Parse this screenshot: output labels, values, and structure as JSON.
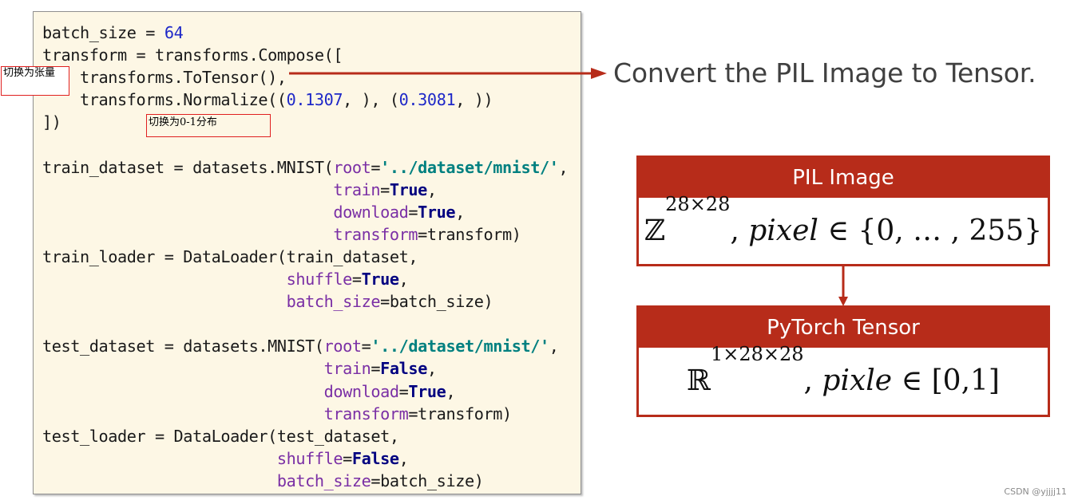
{
  "code": {
    "l01": "batch_size = ",
    "l01_num": "64",
    "l02": "transform = transforms.Compose([",
    "l03": "    transforms.ToTensor(),",
    "l04_a": "    transforms.Normalize((",
    "l04_n1": "0.1307",
    "l04_b": ", ), (",
    "l04_n2": "0.3081",
    "l04_c": ", ))",
    "l05": "])",
    "l07_a": "train_dataset = datasets.MNIST(",
    "l07_kw": "root",
    "l07_eq": "=",
    "l07_str": "'../dataset/mnist/'",
    "l07_end": ",",
    "l08_kw": "train",
    "l08_val": "True",
    "l09_kw": "download",
    "l09_val": "True",
    "l10_kw": "transform",
    "l10_val": "=transform)",
    "l11_a": "train_loader = DataLoader(train_dataset,",
    "l12_kw": "shuffle",
    "l12_val": "True",
    "l13_kw": "batch_size",
    "l13_val": "=batch_size)",
    "l15_a": "test_dataset = datasets.MNIST(",
    "l15_kw": "root",
    "l15_str": "'../dataset/mnist/'",
    "l16_kw": "train",
    "l16_val": "False",
    "l17_kw": "download",
    "l17_val": "True",
    "l18_kw": "transform",
    "l18_val": "=transform)",
    "l19_a": "test_loader = DataLoader(test_dataset,",
    "l20_kw": "shuffle",
    "l20_val": "False",
    "l21_kw": "batch_size",
    "l21_val": "=batch_size)"
  },
  "notes": {
    "to_tensor": "切换为张量",
    "range": "切换为0-1分布"
  },
  "caption": "Convert the PIL Image to Tensor.",
  "boxes": {
    "pil_title": "PIL Image",
    "pil_set": "ℤ",
    "pil_sup": "28×28",
    "pil_var": "pixel",
    "pil_rest": " ∈ {0, … , 255}",
    "tensor_title": "PyTorch Tensor",
    "tensor_set": "ℝ",
    "tensor_sup": "1×28×28",
    "tensor_var": "pixle",
    "tensor_rest": " ∈ [0,1]"
  },
  "watermark": "CSDN @yjjjj11",
  "colors": {
    "accent_red": "#b72c1a",
    "code_bg": "#fdf7e5",
    "number_blue": "#1e28c8",
    "keyword_purple": "#7a2fa5",
    "string_teal": "#008080",
    "bool_navy": "#000080"
  }
}
